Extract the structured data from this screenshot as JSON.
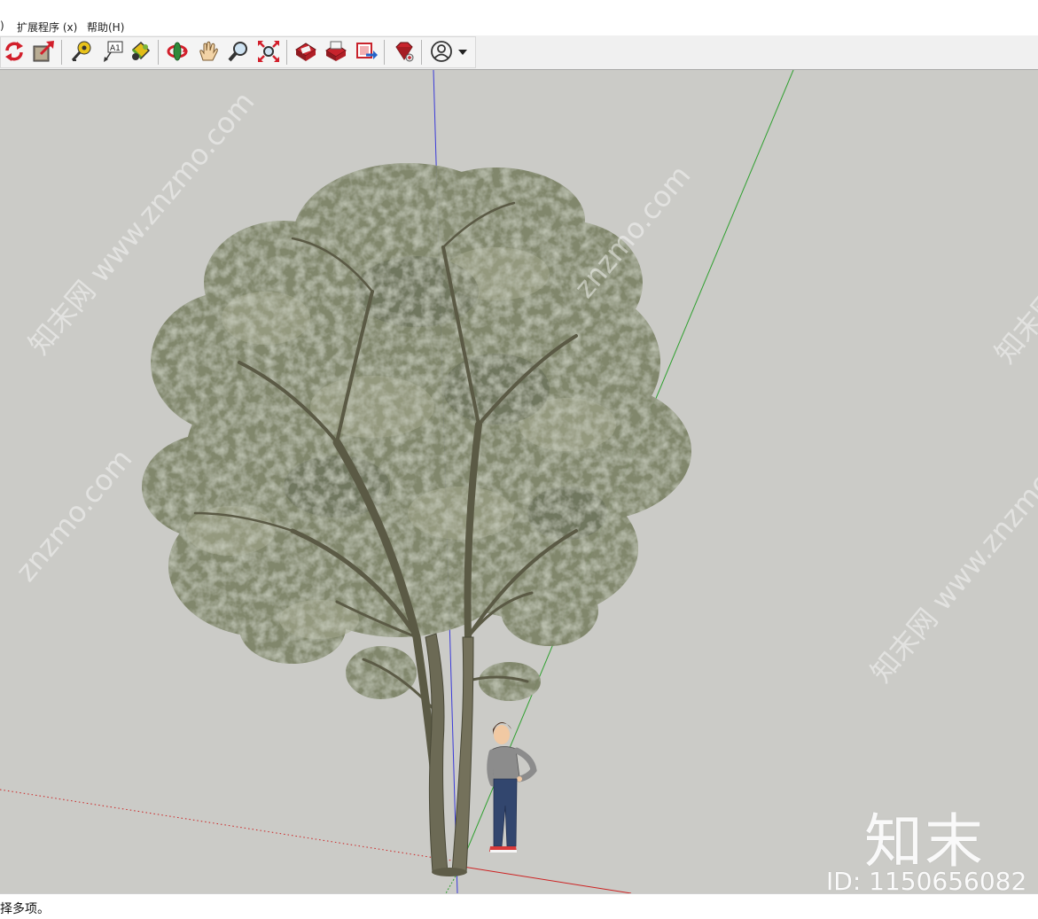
{
  "menu": {
    "items": [
      {
        "label": ")"
      },
      {
        "label": "扩展程序 (x)"
      },
      {
        "label": "帮助(H)"
      }
    ]
  },
  "toolbar": {
    "buttons": [
      {
        "icon": "rotate-refresh-icon"
      },
      {
        "icon": "export-model-icon"
      },
      {
        "icon": "tape-measure-icon"
      },
      {
        "icon": "text-label-icon",
        "label": "A1"
      },
      {
        "icon": "paint-bucket-icon"
      },
      {
        "icon": "orbit-icon"
      },
      {
        "icon": "pan-hand-icon"
      },
      {
        "icon": "zoom-icon"
      },
      {
        "icon": "zoom-extents-icon"
      },
      {
        "icon": "3d-warehouse-icon"
      },
      {
        "icon": "share-model-icon"
      },
      {
        "icon": "extension-warehouse-icon"
      },
      {
        "icon": "ruby-extension-icon"
      },
      {
        "icon": "account-user-icon"
      },
      {
        "icon": "dropdown-arrow-icon"
      }
    ]
  },
  "viewport": {
    "background": "#cbcbc7",
    "axes": {
      "blue": "#3a3ad8",
      "green": "#2fa02f",
      "red": "#cc2222"
    },
    "scene": [
      "tree",
      "person-scale-figure"
    ]
  },
  "watermarks": {
    "text": "知末网 www.znzmo.com",
    "fragments": [
      "知末网 www.znzmo.com",
      "znzmo.com",
      "知末网"
    ]
  },
  "brand": {
    "logo": "知末",
    "id": "ID: 1150656082"
  },
  "status": {
    "text": "择多项。"
  }
}
